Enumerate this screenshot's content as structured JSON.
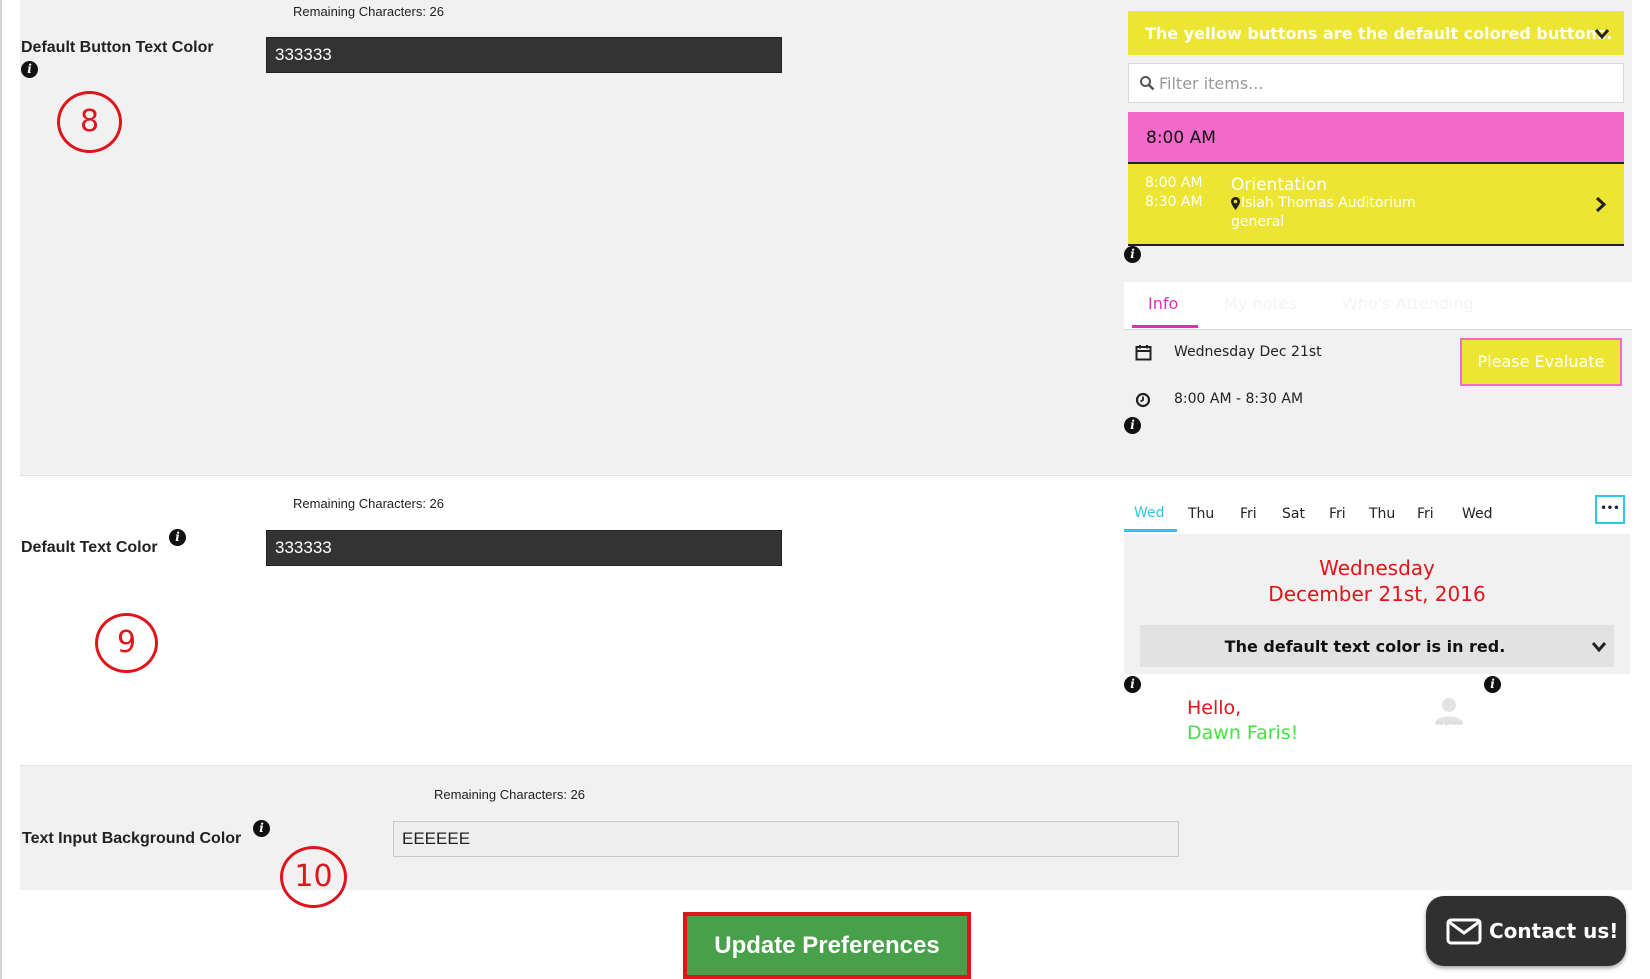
{
  "section_button_text": {
    "remaining": "Remaining Characters: 26",
    "label": "Default Button Text Color",
    "value": "333333",
    "marker": "8"
  },
  "preview_buttons": {
    "banner": "The yellow buttons are the default colored buttons.",
    "filter_placeholder": "Filter items...",
    "time_header": "8:00 AM",
    "event": {
      "start": "8:00 AM",
      "end": "8:30 AM",
      "title": "Orientation",
      "location": "Isiah Thomas Auditorium",
      "category": "general"
    },
    "tabs": [
      "Info",
      "My notes",
      "Who's Attending"
    ],
    "date": "Wednesday Dec 21st",
    "time_range": "8:00 AM - 8:30 AM",
    "evaluate_button": "Please Evaluate"
  },
  "section_text_color": {
    "remaining": "Remaining Characters: 26",
    "label": "Default Text Color",
    "value": "333333",
    "marker": "9"
  },
  "preview_text": {
    "days": [
      "Wed",
      "Thu",
      "Fri",
      "Sat",
      "Fri",
      "Thu",
      "Fri",
      "Wed"
    ],
    "more": "•••",
    "weekday": "Wednesday",
    "date": "December 21st, 2016",
    "dropdown": "The default text color is in red.",
    "hello": "Hello,",
    "name": "Dawn Faris!",
    "photo_caption": "no photo"
  },
  "section_input_bg": {
    "remaining": "Remaining Characters: 26",
    "label": "Text Input Background Color",
    "value": "EEEEEE",
    "marker": "10"
  },
  "update_button": "Update Preferences",
  "contact_button": "Contact us!",
  "colors": {
    "yellow": "#ede534",
    "pink": "#f46acb",
    "red": "#e0151c",
    "green": "#48a04a",
    "dark": "#333333"
  }
}
